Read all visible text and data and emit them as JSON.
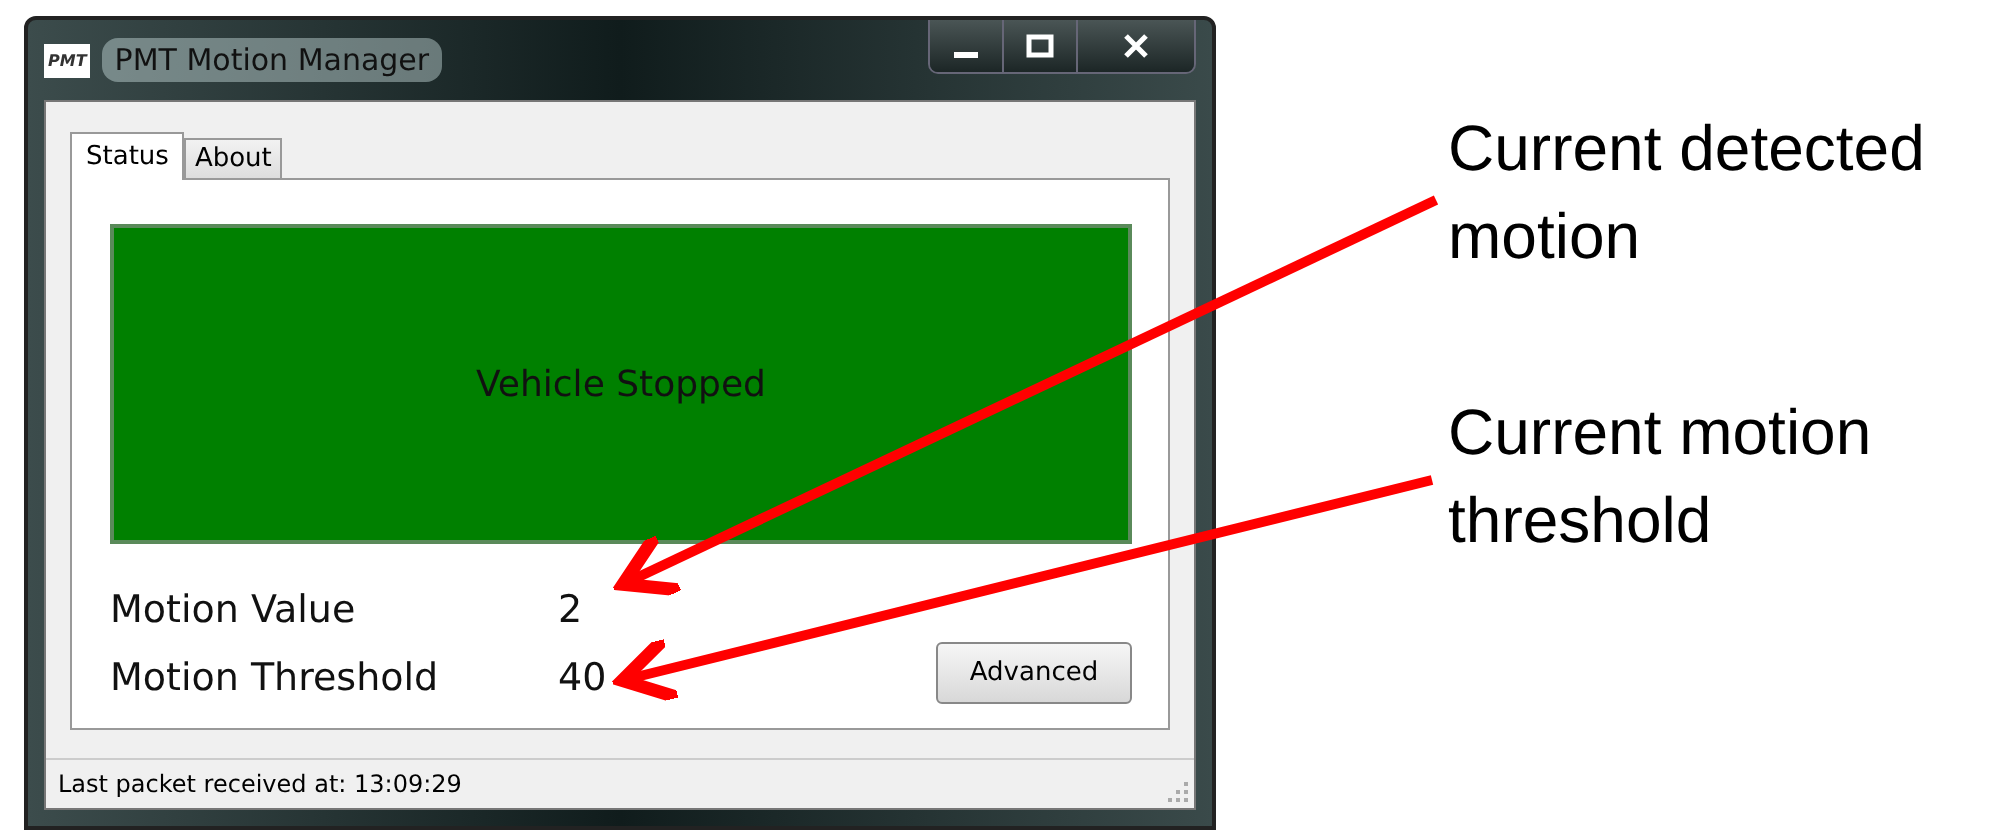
{
  "window": {
    "title": "PMT Motion Manager",
    "logo": "PMT"
  },
  "tabs": [
    {
      "label": "Status",
      "selected": true
    },
    {
      "label": "About",
      "selected": false
    }
  ],
  "status_panel": {
    "text": "Vehicle Stopped"
  },
  "readings": [
    {
      "label": "Motion Value",
      "value": "2"
    },
    {
      "label": "Motion Threshold",
      "value": "40"
    }
  ],
  "advanced_button": "Advanced",
  "status_bar": "Last packet received at: 13:09:29",
  "annotations": [
    "Current detected motion",
    "Current motion threshold"
  ]
}
